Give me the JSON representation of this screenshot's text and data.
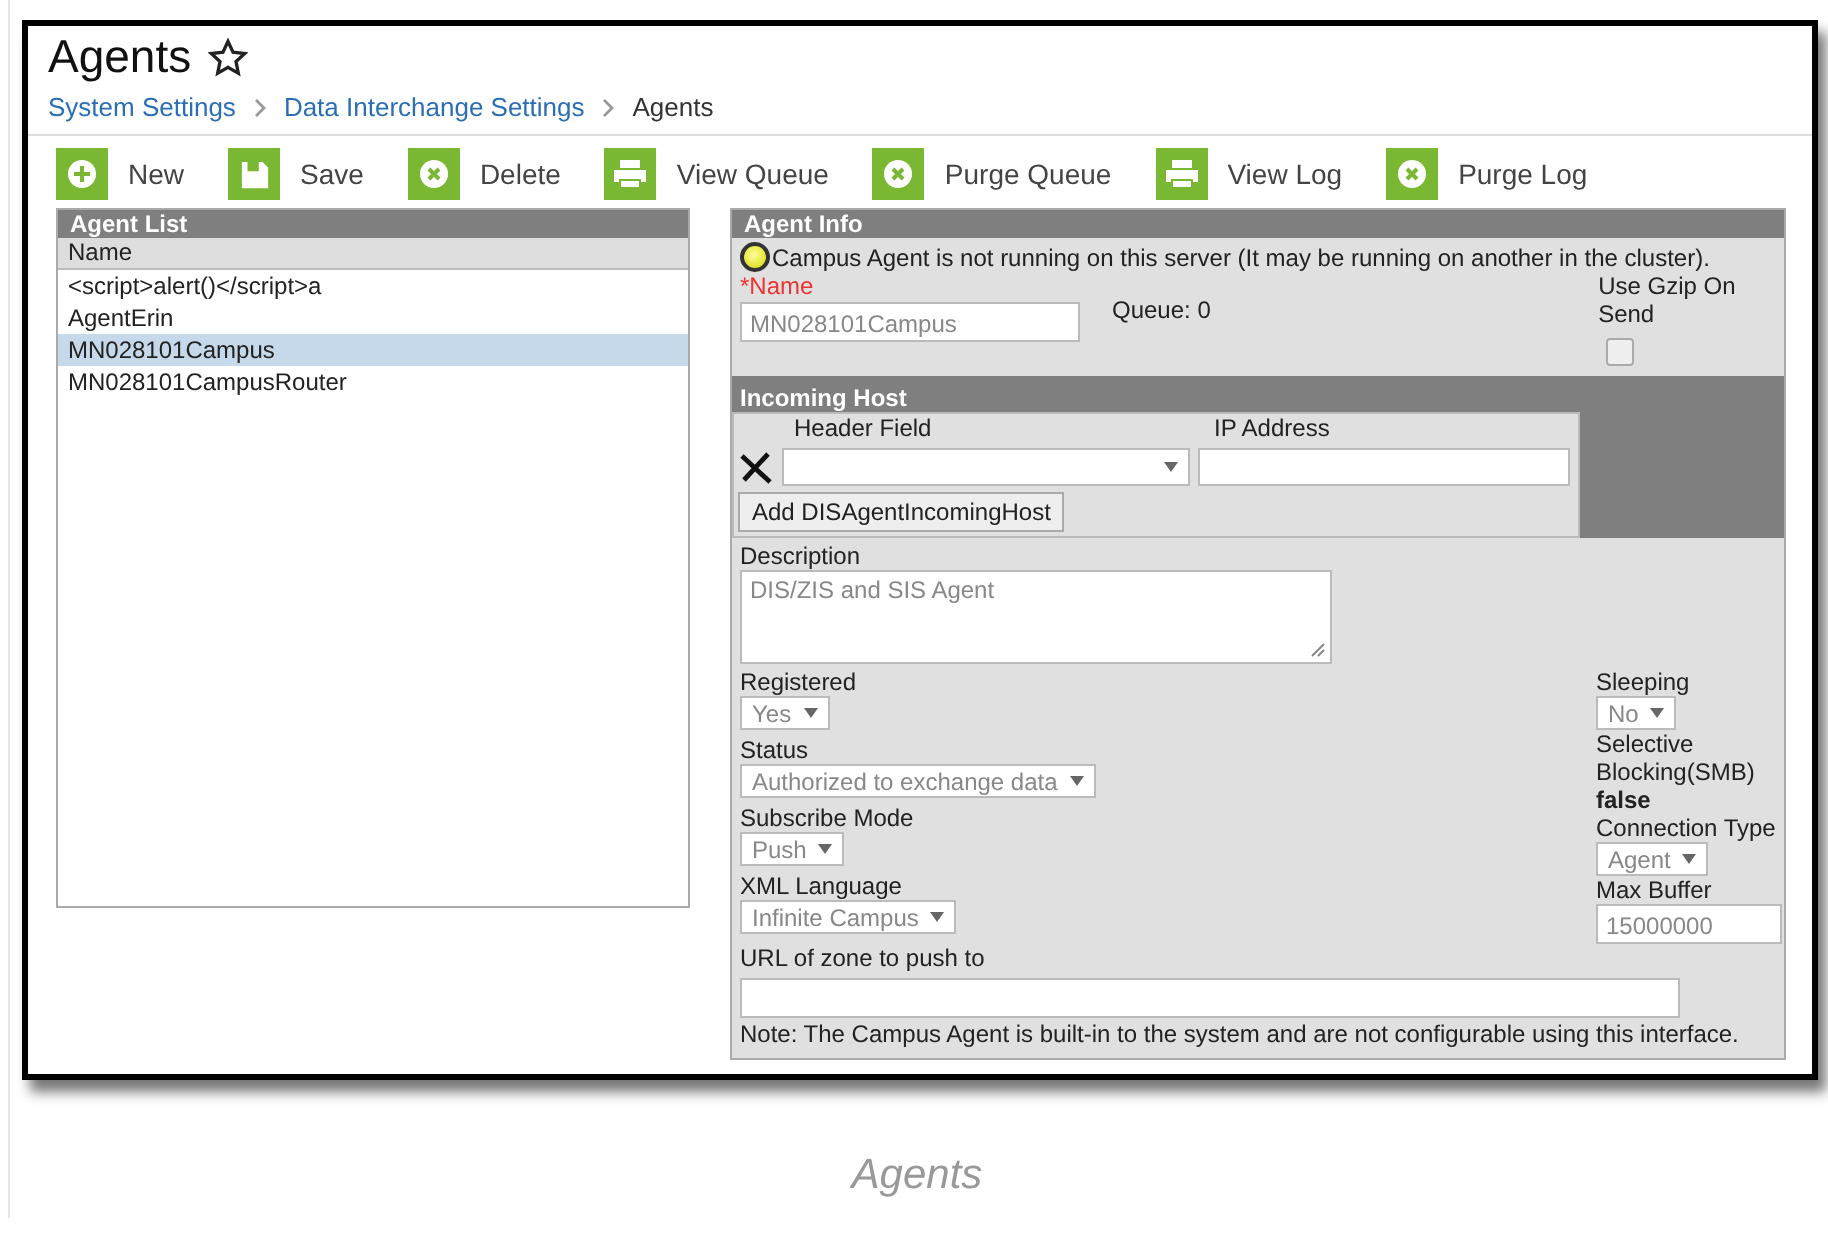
{
  "page": {
    "title": "Agents",
    "favorite": false,
    "breadcrumbs": [
      {
        "label": "System Settings",
        "link": true
      },
      {
        "label": "Data Interchange Settings",
        "link": true
      },
      {
        "label": "Agents",
        "link": false
      }
    ]
  },
  "toolbar": [
    {
      "label": "New",
      "kind": "plus"
    },
    {
      "label": "Save",
      "kind": "save"
    },
    {
      "label": "Delete",
      "kind": "cross"
    },
    {
      "label": "View Queue",
      "kind": "print"
    },
    {
      "label": "Purge Queue",
      "kind": "cross"
    },
    {
      "label": "View Log",
      "kind": "print"
    },
    {
      "label": "Purge Log",
      "kind": "cross"
    }
  ],
  "agent_list": {
    "title": "Agent List",
    "column": "Name",
    "rows": [
      {
        "label": "<script>alert()</script>a",
        "selected": false
      },
      {
        "label": "AgentErin",
        "selected": false
      },
      {
        "label": "MN028101Campus",
        "selected": true
      },
      {
        "label": "MN028101CampusRouter",
        "selected": false
      }
    ]
  },
  "agent_info": {
    "title": "Agent Info",
    "status_message": "Campus Agent is not running on this server (It may be running on another in the cluster).",
    "name": {
      "label": "*Name",
      "required": true,
      "value": "MN028101Campus"
    },
    "queue": "Queue: 0",
    "gzip": {
      "label": "Use Gzip On Send",
      "checked": false
    },
    "incoming_host": {
      "title": "Incoming Host",
      "columns": [
        "Header Field",
        "IP Address"
      ],
      "add_button": "Add DISAgentIncomingHost"
    },
    "description": {
      "label": "Description",
      "value": "DIS/ZIS and SIS Agent"
    },
    "left_fields": [
      {
        "kind": "select",
        "label": "Registered",
        "value": "Yes"
      },
      {
        "kind": "select",
        "label": "Status",
        "value": "Authorized to exchange data"
      },
      {
        "kind": "select",
        "label": "Subscribe Mode",
        "value": "Push"
      },
      {
        "kind": "select",
        "label": "XML Language",
        "value": "Infinite Campus"
      }
    ],
    "right_fields": [
      {
        "kind": "select",
        "label": "Sleeping",
        "value": "No"
      },
      {
        "kind": "text",
        "label": "Selective Blocking(SMB)",
        "value": "false"
      },
      {
        "kind": "select",
        "label": "Connection Type",
        "value": "Agent"
      },
      {
        "kind": "input",
        "label": "Max Buffer",
        "value": "15000000"
      }
    ],
    "url": {
      "label": "URL of zone to push to"
    },
    "note": "Note: The Campus Agent is built-in to the system and are not configurable using this interface."
  },
  "caption": "Agents"
}
